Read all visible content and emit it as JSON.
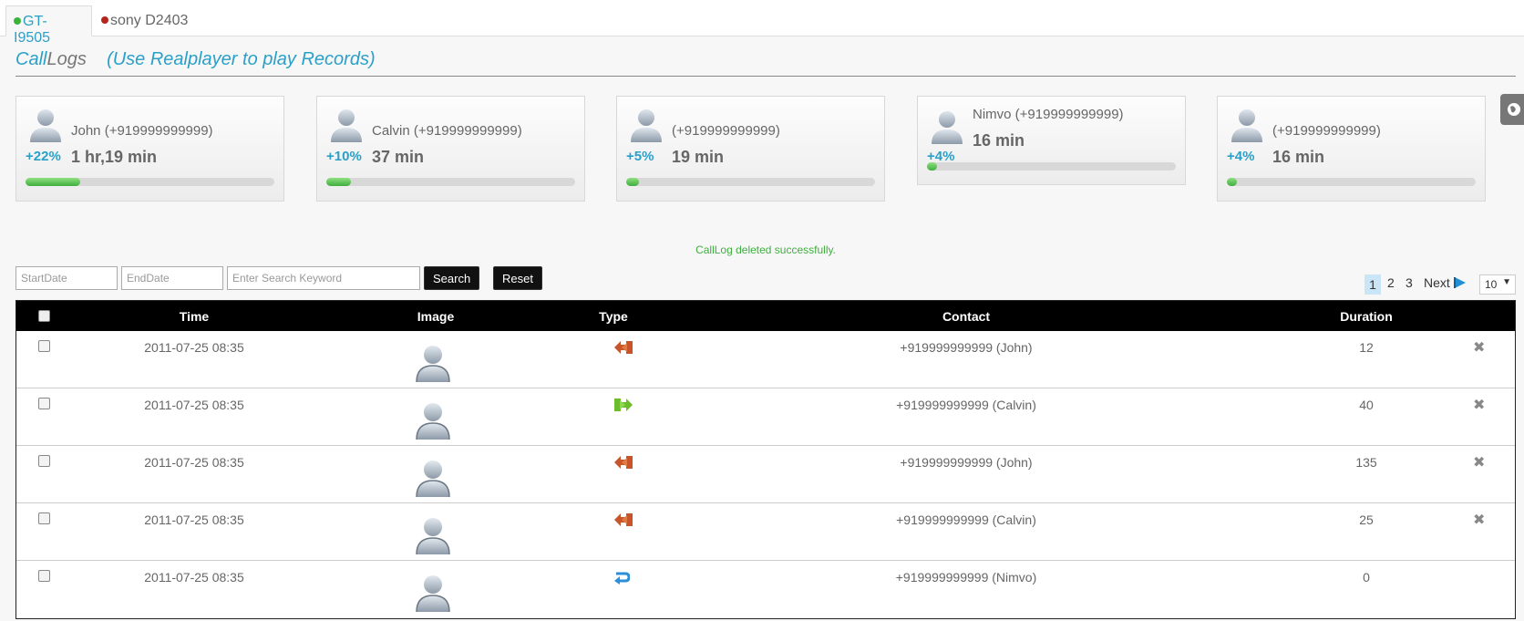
{
  "tabs": [
    {
      "label": "GT-I9505",
      "status_color": "#3bb33b",
      "active": true
    },
    {
      "label": "sony D2403",
      "status_color": "#b3241a",
      "active": false
    }
  ],
  "header": {
    "title_part1": "Call",
    "title_part2": "Logs",
    "subtitle": "(Use Realplayer to play Records)"
  },
  "top_contacts": [
    {
      "name": "John (+919999999999)",
      "percent_label": "+22%",
      "duration": "1 hr,19 min",
      "progress": 0.22
    },
    {
      "name": "Calvin (+919999999999)",
      "percent_label": "+10%",
      "duration": "37 min",
      "progress": 0.1
    },
    {
      "name": "(+919999999999)",
      "percent_label": "+5%",
      "duration": "19 min",
      "progress": 0.05
    },
    {
      "name": "Nimvo (+919999999999)",
      "percent_label": "+4%",
      "duration": "16 min",
      "progress": 0.04
    },
    {
      "name": "(+919999999999)",
      "percent_label": "+4%",
      "duration": "16 min",
      "progress": 0.04
    }
  ],
  "status_message": "CallLog deleted successfully.",
  "filters": {
    "start_date_placeholder": "StartDate",
    "end_date_placeholder": "EndDate",
    "search_placeholder": "Enter Search Keyword",
    "search_label": "Search",
    "reset_label": "Reset"
  },
  "pagination": {
    "pages": [
      "1",
      "2",
      "3"
    ],
    "current": "1",
    "next_label": "Next",
    "page_size": "10"
  },
  "table": {
    "columns": [
      "Time",
      "Image",
      "Type",
      "Contact",
      "Duration"
    ],
    "rows": [
      {
        "time": "2011-07-25 08:35",
        "type": "incoming",
        "contact": "+919999999999 (John)",
        "duration": "12",
        "deletable": true
      },
      {
        "time": "2011-07-25 08:35",
        "type": "outgoing",
        "contact": "+919999999999 (Calvin)",
        "duration": "40",
        "deletable": true
      },
      {
        "time": "2011-07-25 08:35",
        "type": "incoming",
        "contact": "+919999999999 (John)",
        "duration": "135",
        "deletable": true
      },
      {
        "time": "2011-07-25 08:35",
        "type": "incoming",
        "contact": "+919999999999 (Calvin)",
        "duration": "25",
        "deletable": true
      },
      {
        "time": "2011-07-25 08:35",
        "type": "missed",
        "contact": "+919999999999 (Nimvo)",
        "duration": "0",
        "deletable": false
      }
    ]
  },
  "colors": {
    "accent": "#2aa0c8",
    "success": "#3fae3f",
    "incoming": "#c8552a",
    "outgoing": "#6cbd2c",
    "missed": "#2a8fd8"
  }
}
